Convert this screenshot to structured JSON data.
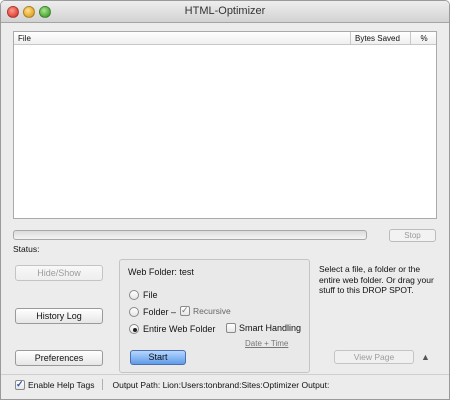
{
  "window": {
    "title": "HTML-Optimizer"
  },
  "file_list": {
    "columns": [
      "File",
      "Bytes Saved",
      "%"
    ],
    "rows": []
  },
  "progress": {
    "stop_label": "Stop",
    "status_label": "Status:",
    "value": 0
  },
  "left_buttons": {
    "hide_show": "Hide/Show",
    "history_log": "History Log",
    "preferences": "Preferences"
  },
  "options": {
    "web_folder_label": "Web Folder: test",
    "radio_file": "File",
    "radio_folder": "Folder –",
    "radio_entire": "Entire Web Folder",
    "selected": "Entire Web Folder",
    "recursive_label": "Recursive",
    "recursive_checked": true,
    "smart_label": "Smart Handling",
    "smart_checked": false,
    "date_time": "Date + Time",
    "start_label": "Start"
  },
  "drop_spot": {
    "help_text": "Select a file, a folder or the entire web folder. Or drag your stuff to this DROP SPOT.",
    "view_page_label": "View Page"
  },
  "footer": {
    "help_tags_label": "Enable Help Tags",
    "help_tags_checked": true,
    "output_path": "Output Path: Lion:Users:tonbrand:Sites:Optimizer Output:"
  }
}
